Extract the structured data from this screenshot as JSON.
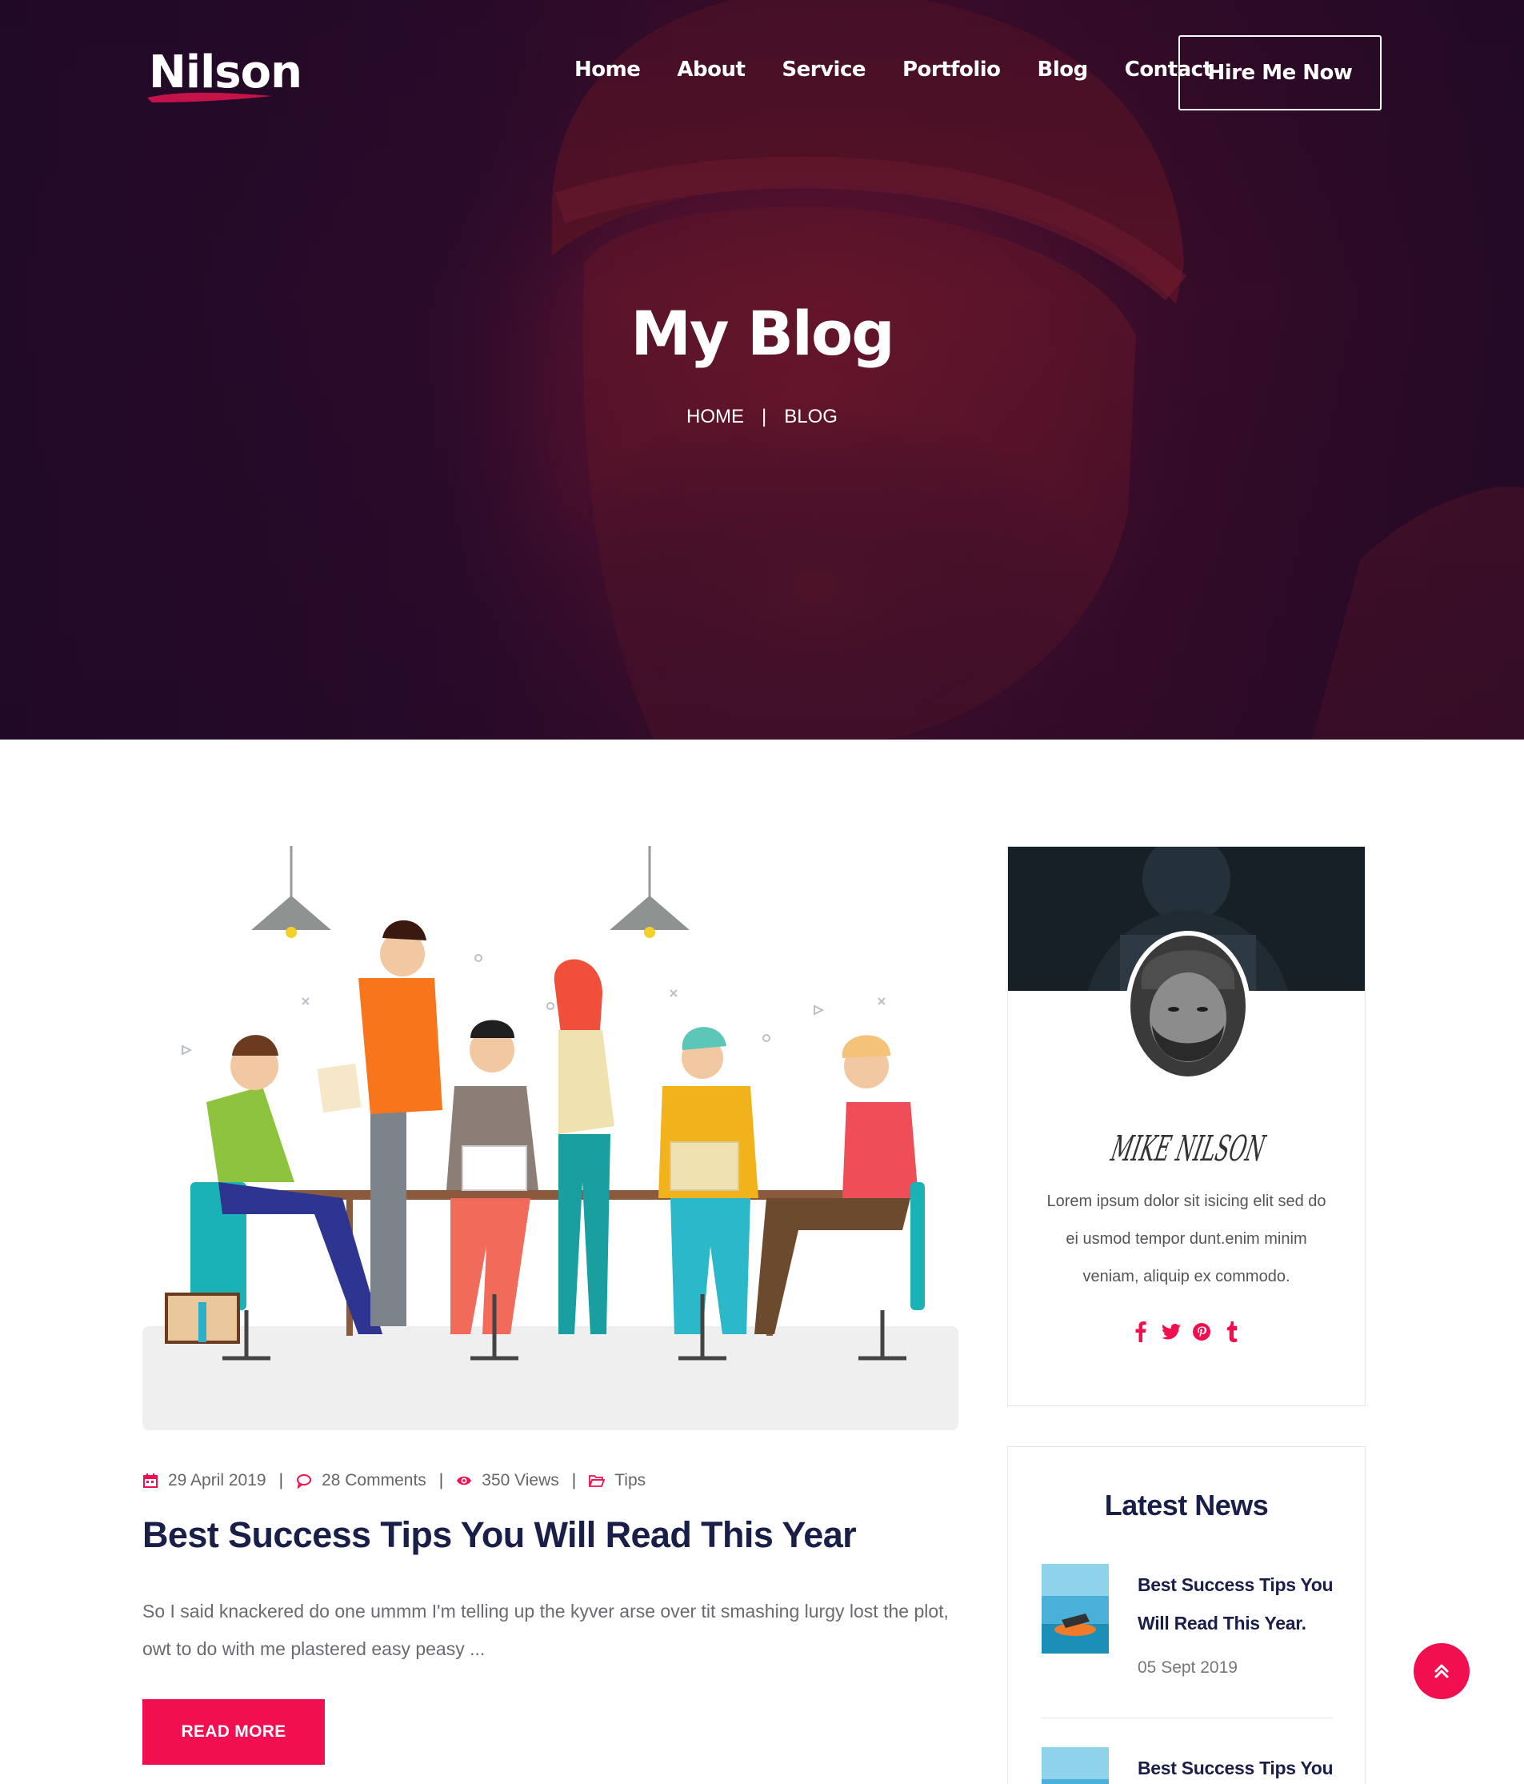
{
  "header": {
    "logo": "Nilson",
    "nav": [
      "Home",
      "About",
      "Service",
      "Portfolio",
      "Blog",
      "Contact"
    ],
    "cta": "Hire Me Now"
  },
  "hero": {
    "title": "My Blog",
    "breadcrumb": {
      "home": "HOME",
      "separator": "|",
      "current": "BLOG"
    }
  },
  "post": {
    "meta": {
      "date": "29 April 2019",
      "comments": "28 Comments",
      "views": "350 Views",
      "category": "Tips",
      "separator": "|"
    },
    "title": "Best Success Tips You Will Read This Year",
    "excerpt": "So I said knackered do one ummm I'm telling up the kyver arse over tit smashing lurgy lost the plot, owt to do with me plastered easy peasy ...",
    "read_more": "READ MORE"
  },
  "sidebar": {
    "profile": {
      "signature": "MIKE NILSON",
      "bio": "Lorem ipsum dolor sit isicing elit sed do ei usmod tempor dunt.enim minim veniam, aliquip ex commodo.",
      "social": [
        "facebook-icon",
        "twitter-icon",
        "pinterest-icon",
        "tumblr-icon"
      ]
    },
    "latest_news": {
      "heading": "Latest News",
      "items": [
        {
          "title": "Best Success Tips You Will Read This Year.",
          "date": "05 Sept 2019"
        },
        {
          "title": "Best Success Tips You",
          "date": ""
        }
      ]
    }
  },
  "colors": {
    "accent": "#f20f4f",
    "heading": "#1a1f4a",
    "hero_base": "#2a0b2c"
  }
}
